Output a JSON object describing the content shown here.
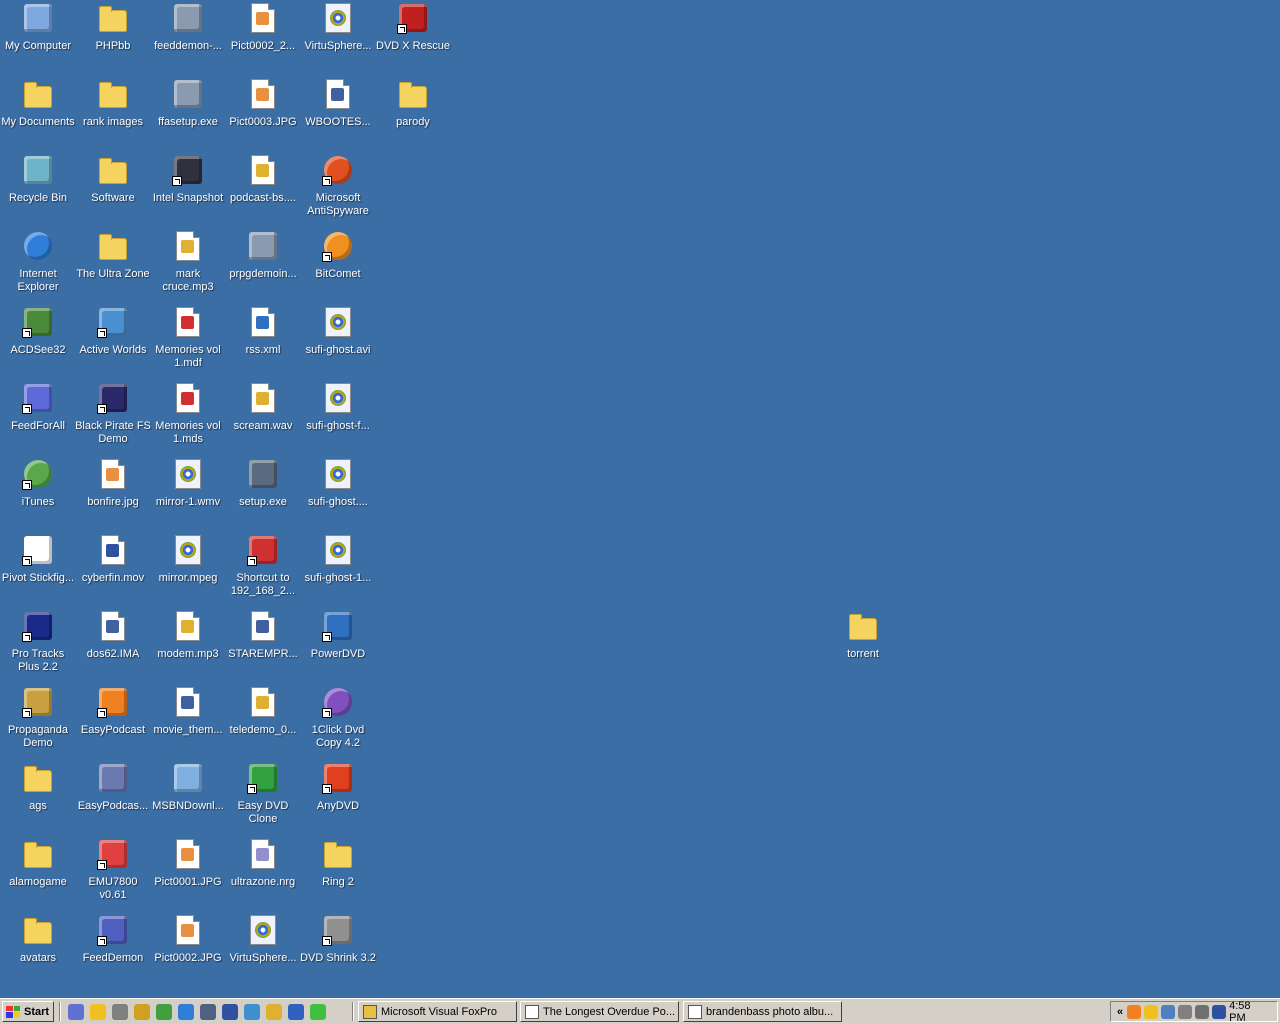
{
  "desktop": {
    "background_color": "#3A6EA5",
    "icons": [
      {
        "label": "My Computer",
        "icon": "my-computer-icon",
        "shortcut": false
      },
      {
        "label": "My Documents",
        "icon": "my-documents-icon",
        "shortcut": false
      },
      {
        "label": "Recycle Bin",
        "icon": "recycle-bin-icon",
        "shortcut": false
      },
      {
        "label": "Internet Explorer",
        "icon": "internet-explorer-icon",
        "shortcut": false
      },
      {
        "label": "ACDSee32",
        "icon": "acdsee-icon",
        "shortcut": true
      },
      {
        "label": "FeedForAll",
        "icon": "feedforall-icon",
        "shortcut": true
      },
      {
        "label": "iTunes",
        "icon": "itunes-icon",
        "shortcut": true
      },
      {
        "label": "Pivot Stickfig...",
        "icon": "pivot-stickfigure-icon",
        "shortcut": true
      },
      {
        "label": "Pro Tracks Plus 2.2",
        "icon": "pro-tracks-icon",
        "shortcut": true
      },
      {
        "label": "Propaganda Demo",
        "icon": "propaganda-icon",
        "shortcut": true
      },
      {
        "label": "ags",
        "icon": "folder-icon",
        "shortcut": false
      },
      {
        "label": "alamogame",
        "icon": "folder-icon",
        "shortcut": false
      },
      {
        "label": "avatars",
        "icon": "folder-icon",
        "shortcut": false
      },
      {
        "label": "PHPbb",
        "icon": "folder-icon",
        "shortcut": false
      },
      {
        "label": "rank images",
        "icon": "folder-icon",
        "shortcut": false
      },
      {
        "label": "Software",
        "icon": "folder-icon",
        "shortcut": false
      },
      {
        "label": "The Ultra Zone",
        "icon": "folder-icon",
        "shortcut": false
      },
      {
        "label": "Active Worlds",
        "icon": "active-worlds-icon",
        "shortcut": true
      },
      {
        "label": "Black Pirate FS Demo",
        "icon": "black-pirate-icon",
        "shortcut": true
      },
      {
        "label": "bonfire.jpg",
        "icon": "image-file-icon",
        "shortcut": false
      },
      {
        "label": "cyberfin.mov",
        "icon": "quicktime-file-icon",
        "shortcut": false
      },
      {
        "label": "dos62.IMA",
        "icon": "document-icon",
        "shortcut": false
      },
      {
        "label": "EasyPodcast",
        "icon": "easypodcast-icon",
        "shortcut": true
      },
      {
        "label": "EasyPodcas...",
        "icon": "easypodcast-setup-icon",
        "shortcut": false
      },
      {
        "label": "EMU7800 v0.61",
        "icon": "emu7800-icon",
        "shortcut": true
      },
      {
        "label": "FeedDemon",
        "icon": "feeddemon-icon",
        "shortcut": true
      },
      {
        "label": "feeddemon-...",
        "icon": "installer-icon",
        "shortcut": false
      },
      {
        "label": "ffasetup.exe",
        "icon": "installer-icon",
        "shortcut": false
      },
      {
        "label": "Intel Snapshot",
        "icon": "intel-snapshot-icon",
        "shortcut": true
      },
      {
        "label": "mark cruce.mp3",
        "icon": "audio-file-icon",
        "shortcut": false
      },
      {
        "label": "Memories vol 1.mdf",
        "icon": "mdf-file-icon",
        "shortcut": false
      },
      {
        "label": "Memories vol 1.mds",
        "icon": "mds-file-icon",
        "shortcut": false
      },
      {
        "label": "mirror-1.wmv",
        "icon": "video-file-icon",
        "shortcut": false
      },
      {
        "label": "mirror.mpeg",
        "icon": "video-file-icon",
        "shortcut": false
      },
      {
        "label": "modem.mp3",
        "icon": "audio-file-icon",
        "shortcut": false
      },
      {
        "label": "movie_them...",
        "icon": "document-icon",
        "shortcut": false
      },
      {
        "label": "MSBNDownl...",
        "icon": "msbn-icon",
        "shortcut": false
      },
      {
        "label": "Pict0001.JPG",
        "icon": "image-file-icon",
        "shortcut": false
      },
      {
        "label": "Pict0002.JPG",
        "icon": "image-file-icon",
        "shortcut": false
      },
      {
        "label": "Pict0002_2...",
        "icon": "image-file-icon",
        "shortcut": false
      },
      {
        "label": "Pict0003.JPG",
        "icon": "image-file-icon",
        "shortcut": false
      },
      {
        "label": "podcast-bs....",
        "icon": "audio-file-icon",
        "shortcut": false
      },
      {
        "label": "prpgdemoin...",
        "icon": "installer-icon",
        "shortcut": false
      },
      {
        "label": "rss.xml",
        "icon": "xml-file-icon",
        "shortcut": false
      },
      {
        "label": "scream.wav",
        "icon": "audio-file-icon",
        "shortcut": false
      },
      {
        "label": "setup.exe",
        "icon": "setup-icon",
        "shortcut": false
      },
      {
        "label": "Shortcut to 192_168_2...",
        "icon": "network-kite-icon",
        "shortcut": true
      },
      {
        "label": "STAREMPR...",
        "icon": "document-icon",
        "shortcut": false
      },
      {
        "label": "teledemo_0...",
        "icon": "audio-file-icon",
        "shortcut": false
      },
      {
        "label": "Easy DVD Clone",
        "icon": "easy-dvd-clone-icon",
        "shortcut": true
      },
      {
        "label": "ultrazone.nrg",
        "icon": "disc-image-icon",
        "shortcut": false
      },
      {
        "label": "VirtuSphere...",
        "icon": "video-file-icon",
        "shortcut": false
      },
      {
        "label": "VirtuSphere...",
        "icon": "video-file-icon",
        "shortcut": false
      },
      {
        "label": "WBOOTES...",
        "icon": "document-icon",
        "shortcut": false
      },
      {
        "label": "Microsoft AntiSpyware",
        "icon": "antispyware-icon",
        "shortcut": true
      },
      {
        "label": "BitComet",
        "icon": "bitcomet-icon",
        "shortcut": true
      },
      {
        "label": "sufi-ghost.avi",
        "icon": "video-file-icon",
        "shortcut": false
      },
      {
        "label": "sufi-ghost-f...",
        "icon": "video-file-icon",
        "shortcut": false
      },
      {
        "label": "sufi-ghost....",
        "icon": "video-file-icon",
        "shortcut": false
      },
      {
        "label": "sufi-ghost-1...",
        "icon": "video-file-icon",
        "shortcut": false
      },
      {
        "label": "PowerDVD",
        "icon": "powerdvd-icon",
        "shortcut": true
      },
      {
        "label": "1Click Dvd Copy 4.2",
        "icon": "1click-dvd-icon",
        "shortcut": true
      },
      {
        "label": "AnyDVD",
        "icon": "anydvd-fox-icon",
        "shortcut": true
      },
      {
        "label": "Ring 2",
        "icon": "folder-icon",
        "shortcut": false
      },
      {
        "label": "DVD Shrink 3.2",
        "icon": "dvd-shrink-icon",
        "shortcut": true
      },
      {
        "label": "DVD X Rescue",
        "icon": "dvd-x-rescue-icon",
        "shortcut": true
      },
      {
        "label": "parody",
        "icon": "folder-icon",
        "shortcut": false
      },
      {
        "label": "torrent",
        "icon": "folder-icon",
        "shortcut": false
      }
    ]
  },
  "taskbar": {
    "start_label": "Start",
    "quick_launch": [
      "feeddemon-icon",
      "aim-icon",
      "tool-icon",
      "winamp-icon",
      "music-icon",
      "internet-explorer-icon",
      "network-icon",
      "winzip-icon",
      "messenger-icon",
      "audio-icon",
      "media-player-icon",
      "green-app-icon"
    ],
    "tasks": [
      {
        "label": "Microsoft Visual FoxPro",
        "icon": "foxpro-icon"
      },
      {
        "label": "The Longest Overdue Po...",
        "icon": "browser-window-icon"
      },
      {
        "label": "brandenbass photo albu...",
        "icon": "browser-window-icon"
      }
    ],
    "tray": {
      "expand_label": "«",
      "icons": [
        "firefox-tray-icon",
        "aim-tray-icon",
        "network-tray-icon",
        "volume-tray-icon",
        "antispyware-tray-icon",
        "mail-tray-icon"
      ],
      "clock": "4:58 PM"
    }
  }
}
